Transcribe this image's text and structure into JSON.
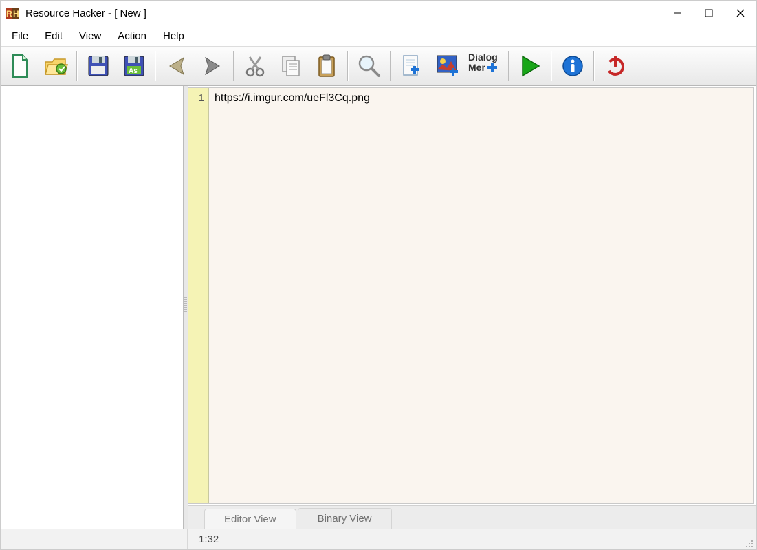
{
  "title": "Resource Hacker - [ New ]",
  "menu": {
    "file": "File",
    "edit": "Edit",
    "view": "View",
    "action": "Action",
    "help": "Help"
  },
  "toolbar": {
    "new": "new-file-icon",
    "open": "open-folder-icon",
    "save": "save-icon",
    "save_as": "save-as-icon",
    "back": "nav-back-icon",
    "forward": "nav-forward-icon",
    "cut": "cut-icon",
    "copy": "copy-icon",
    "paste": "paste-icon",
    "find": "search-icon",
    "new_script": "new-script-icon",
    "add_image": "add-image-icon",
    "dialog_label_top": "Dialog",
    "dialog_label_bottom": "Mer",
    "run": "play-icon",
    "info": "info-icon",
    "power": "power-icon"
  },
  "editor": {
    "line_number": "1",
    "content": "https://i.imgur.com/ueFl3Cq.png"
  },
  "tabs": {
    "editor_view": "Editor View",
    "binary_view": "Binary View"
  },
  "status": {
    "pos": "1:32"
  }
}
